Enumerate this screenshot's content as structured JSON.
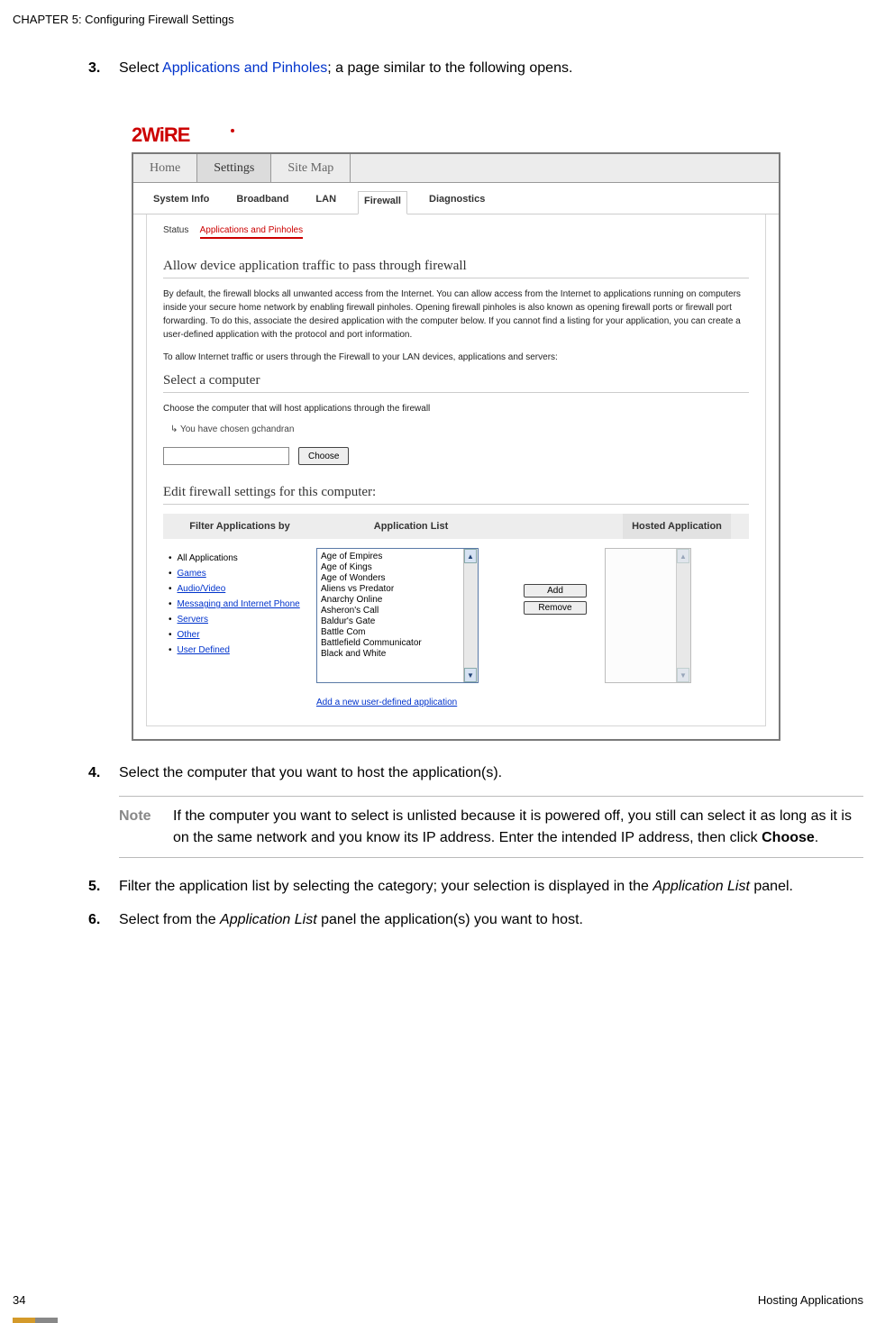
{
  "header": {
    "chapter": "CHAPTER 5: Configuring Firewall Settings"
  },
  "steps": {
    "s3": {
      "num": "3.",
      "pre": "Select ",
      "link": "Applications and Pinholes",
      "post": "; a page similar to the following opens."
    },
    "s4": {
      "num": "4.",
      "text": "Select the computer that you want to host the application(s)."
    },
    "s5": {
      "num": "5.",
      "pre": "Filter the application list by selecting the category; your selection is displayed in the ",
      "em": "Application List",
      "post": " panel."
    },
    "s6": {
      "num": "6.",
      "pre": "Select from the ",
      "em": "Application List",
      "post": " panel the application(s) you want to host."
    }
  },
  "note": {
    "label": "Note",
    "text_pre": "If the computer you want to select is unlisted because it is powered off, you still can select it as long as it is on the same network and you know its IP address. Enter the intended IP address, then click ",
    "bold": "Choose",
    "text_post": "."
  },
  "screenshot": {
    "tabs": {
      "home": "Home",
      "settings": "Settings",
      "sitemap": "Site Map"
    },
    "subnav": {
      "sysinfo": "System Info",
      "broadband": "Broadband",
      "lan": "LAN",
      "firewall": "Firewall",
      "diagnostics": "Diagnostics"
    },
    "status": {
      "label": "Status",
      "link": "Applications and Pinholes"
    },
    "headings": {
      "allow": "Allow device application traffic to pass through firewall",
      "select_computer": "Select a computer",
      "edit": "Edit firewall settings for this computer:"
    },
    "paras": {
      "p1": "By default, the firewall blocks all unwanted access from the Internet. You can allow access from the Internet to applications running on computers inside your secure home network by enabling firewall pinholes. Opening firewall pinholes is also known as opening firewall ports or firewall port forwarding. To do this, associate the desired application with the computer below. If you cannot find a listing for your application, you can create a user-defined application with the protocol and port information.",
      "p2": "To allow Internet traffic or users through the Firewall to your LAN devices, applications and servers:",
      "choose_text": "Choose the computer that will host applications through the firewall",
      "chosen": "You have chosen gchandran"
    },
    "choose_btn": "Choose",
    "tableheads": {
      "filter": "Filter Applications by",
      "applist": "Application List",
      "hosted": "Hosted Application"
    },
    "filters": {
      "all": "All Applications",
      "games": "Games",
      "audio": "Audio/Video",
      "msg": "Messaging and Internet Phone",
      "servers": "Servers",
      "other": "Other",
      "user": "User Defined"
    },
    "applist_items": [
      "Age of Empires",
      "Age of Kings",
      "Age of Wonders",
      "Aliens vs Predator",
      "Anarchy Online",
      "Asheron's Call",
      "Baldur's Gate",
      "Battle Com",
      "Battlefield Communicator",
      "Black and White"
    ],
    "buttons": {
      "add": "Add",
      "remove": "Remove"
    },
    "add_link": "Add a new user-defined application"
  },
  "footer": {
    "page": "34",
    "section": "Hosting Applications"
  }
}
